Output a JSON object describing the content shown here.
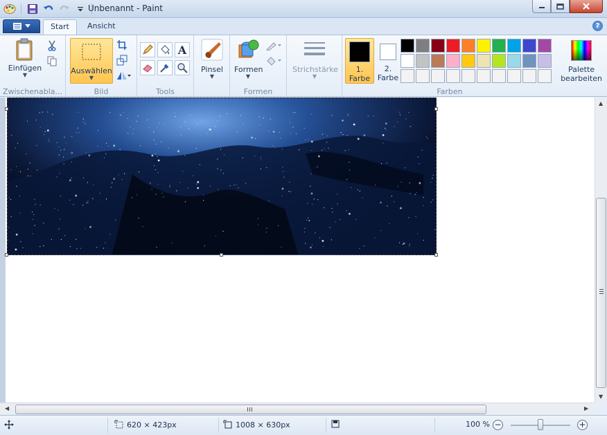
{
  "window": {
    "title": "Unbenannt - Paint"
  },
  "tabs": [
    {
      "label": "Start"
    },
    {
      "label": "Ansicht"
    }
  ],
  "help": {
    "label": "?"
  },
  "ribbon": {
    "clipboard": {
      "paste_label": "Einfügen",
      "group_label": "Zwischenabla..."
    },
    "image": {
      "select_label": "Auswählen",
      "group_label": "Bild"
    },
    "tools": {
      "group_label": "Tools",
      "text_glyph": "A"
    },
    "brushes": {
      "label": "Pinsel"
    },
    "shapes": {
      "label": "Formen",
      "group_label": "Formen"
    },
    "size": {
      "label": "Strichstärke"
    },
    "colors": {
      "color1_label": "1.\nFarbe",
      "color1_line1": "1.",
      "color1_line2": "Farbe",
      "color1_value": "#000000",
      "color2_line1": "2.",
      "color2_line2": "Farbe",
      "color2_value": "#ffffff",
      "edit_line1": "Palette",
      "edit_line2": "bearbeiten",
      "group_label": "Farben",
      "palette": [
        "#000000",
        "#7f7f7f",
        "#880015",
        "#ed1c24",
        "#ff7f27",
        "#fff200",
        "#22b14c",
        "#00a2e8",
        "#3f48cc",
        "#a349a4",
        "#ffffff",
        "#c3c3c3",
        "#b97a57",
        "#ffaec9",
        "#ffc90e",
        "#efe4b0",
        "#b5e61d",
        "#99d9ea",
        "#7092be",
        "#c8bfe7",
        "#f3f3f3",
        "#f3f3f3",
        "#f3f3f3",
        "#f3f3f3",
        "#f3f3f3",
        "#f3f3f3",
        "#f3f3f3",
        "#f3f3f3",
        "#f3f3f3",
        "#f3f3f3"
      ]
    }
  },
  "status": {
    "selection_size": "620 × 423px",
    "canvas_size": "1008 × 630px",
    "zoom": "100 %",
    "zoom_level": 0.5
  }
}
